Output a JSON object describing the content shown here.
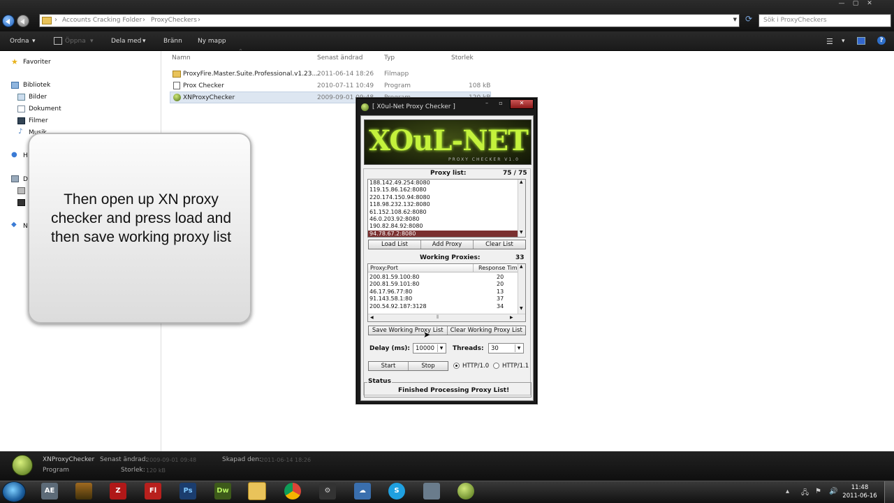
{
  "explorer": {
    "address": {
      "crumbs": [
        "Accounts Cracking Folder",
        "ProxyCheckers"
      ]
    },
    "search_placeholder": "Sök i ProxyCheckers",
    "toolbar": {
      "organize": "Ordna",
      "open": "Öppna",
      "share": "Dela med",
      "burn": "Bränn",
      "new_folder": "Ny mapp"
    },
    "nav": {
      "favorites": "Favoriter",
      "libraries": "Bibliotek",
      "library_items": [
        "Bilder",
        "Dokument",
        "Filmer",
        "Musik"
      ],
      "partial": [
        "H",
        "D",
        "N"
      ]
    },
    "columns": {
      "name": "Namn",
      "modified": "Senast ändrad",
      "type": "Typ",
      "size": "Storlek"
    },
    "files": [
      {
        "name": "ProxyFire.Master.Suite.Professional.v1.23....",
        "modified": "2011-06-14 18:26",
        "type": "Filmapp",
        "size": "",
        "icon": "folder-icon"
      },
      {
        "name": "Prox Checker",
        "modified": "2010-07-11 10:49",
        "type": "Program",
        "size": "108 kB",
        "icon": "app-icon"
      },
      {
        "name": "XNProxyChecker",
        "modified": "2009-09-01 09:48",
        "type": "Program",
        "size": "120 kB",
        "icon": "xn-app-icon"
      }
    ]
  },
  "overlay": {
    "text": "Then open up XN proxy checker and press load and then save working proxy list"
  },
  "checker": {
    "title": "[ X0ul-Net Proxy Checker ]",
    "banner_logo": "XOuL-NET",
    "banner_sub": "PROXY CHECKER V1.0",
    "proxy_list_label": "Proxy list:",
    "proxy_count": "75 / 75",
    "proxies": [
      "188.142.49.254:8080",
      "119.15.86.162:8080",
      "220.174.150.94:8080",
      "118.98.232.132:8080",
      "61.152.108.62:8080",
      "46.0.203.92:8080",
      "190.82.84.92:8080",
      "94.78.67.2:8080"
    ],
    "buttons": {
      "load": "Load List",
      "add": "Add Proxy",
      "clear": "Clear List",
      "save_working": "Save Working Proxy List",
      "clear_working": "Clear Working Proxy List",
      "start": "Start",
      "stop": "Stop"
    },
    "working_label": "Working Proxies:",
    "working_count": "33",
    "working_columns": [
      "Proxy:Port",
      "Response Tim"
    ],
    "working": [
      {
        "proxy": "200.81.59.100:80",
        "ms": "20"
      },
      {
        "proxy": "200.81.59.101:80",
        "ms": "20"
      },
      {
        "proxy": "46.17.96.77:80",
        "ms": "13"
      },
      {
        "proxy": "91.143.58.1:80",
        "ms": "37"
      },
      {
        "proxy": "200.54.92.187:3128",
        "ms": "34"
      }
    ],
    "delay_label": "Delay (ms):",
    "delay_value": "10000",
    "threads_label": "Threads:",
    "threads_value": "30",
    "http10": "HTTP/1.0",
    "http11": "HTTP/1.1",
    "status_label": "Status",
    "status_text": "Finished Processing Proxy List!"
  },
  "details": {
    "name": "XNProxyChecker",
    "type": "Program",
    "modified_label": "Senast ändrad:",
    "modified": "2009-09-01 09:48",
    "size_label": "Storlek:",
    "size": "120 kB",
    "created_label": "Skapad den:",
    "created": "2011-06-14 18:26"
  },
  "taskbar": {
    "apps": [
      "AE",
      "",
      "",
      "Fl",
      "Ps",
      "Dw",
      "",
      "",
      "",
      "",
      "",
      "",
      ""
    ],
    "time": "11:48",
    "date": "2011-06-16"
  }
}
